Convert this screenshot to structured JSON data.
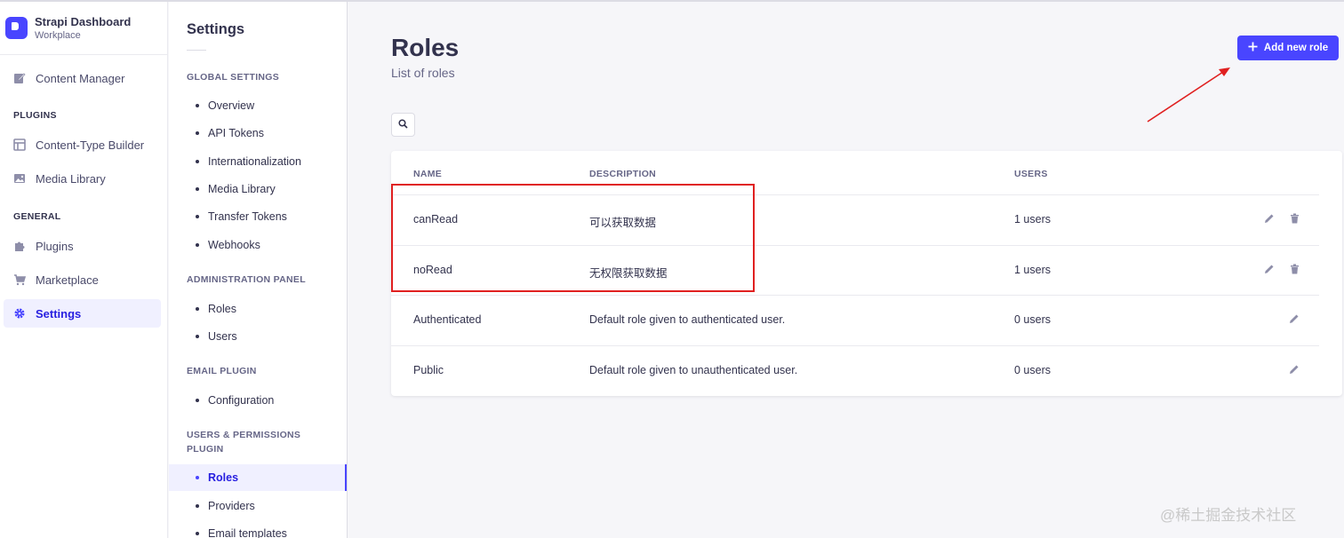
{
  "app": {
    "name": "Strapi Dashboard",
    "workspace": "Workplace"
  },
  "mainnav": {
    "content_manager": "Content Manager",
    "plugins_section": "PLUGINS",
    "content_type_builder": "Content-Type Builder",
    "media_library": "Media Library",
    "general_section": "GENERAL",
    "plugins": "Plugins",
    "marketplace": "Marketplace",
    "settings": "Settings"
  },
  "subnav": {
    "title": "Settings",
    "global_section": "GLOBAL SETTINGS",
    "global_items": [
      "Overview",
      "API Tokens",
      "Internationalization",
      "Media Library",
      "Transfer Tokens",
      "Webhooks"
    ],
    "admin_section": "ADMINISTRATION PANEL",
    "admin_items": [
      "Roles",
      "Users"
    ],
    "email_section": "EMAIL PLUGIN",
    "email_items": [
      "Configuration"
    ],
    "up_section": "USERS & PERMISSIONS PLUGIN",
    "up_items": [
      "Roles",
      "Providers",
      "Email templates"
    ]
  },
  "page": {
    "title": "Roles",
    "subtitle": "List of roles",
    "add_button": "Add new role"
  },
  "table": {
    "headers": {
      "name": "NAME",
      "description": "DESCRIPTION",
      "users": "USERS"
    },
    "rows": [
      {
        "name": "canRead",
        "description": "可以获取数据",
        "users": "1 users"
      },
      {
        "name": "noRead",
        "description": "无权限获取数据",
        "users": "1 users"
      },
      {
        "name": "Authenticated",
        "description": "Default role given to authenticated user.",
        "users": "0 users"
      },
      {
        "name": "Public",
        "description": "Default role given to unauthenticated user.",
        "users": "0 users"
      }
    ]
  },
  "watermark": "@稀土掘金技术社区",
  "colors": {
    "primary": "#4945ff",
    "annotation": "#e02020"
  }
}
